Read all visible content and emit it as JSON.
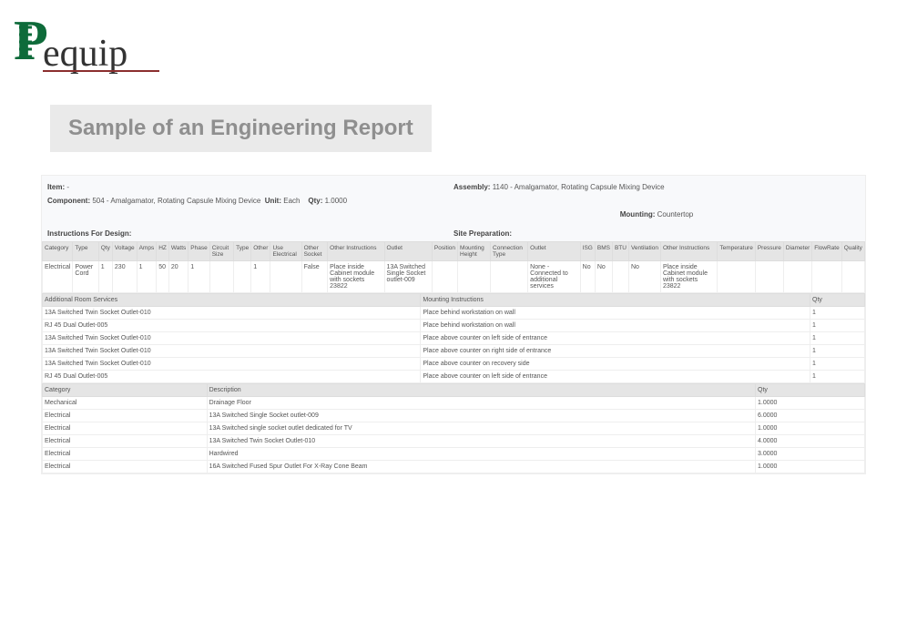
{
  "logo_text": "equip",
  "page_title": "Sample of an Engineering Report",
  "meta": {
    "item_label": "Item:",
    "item_value": "-",
    "assembly_label": "Assembly:",
    "assembly_value": "1140 - Amalgamator, Rotating Capsule Mixing Device",
    "component_label": "Component:",
    "component_value": "504 - Amalgamator, Rotating Capsule Mixing Device",
    "unit_label": "Unit:",
    "unit_value": "Each",
    "qty_label": "Qty:",
    "qty_value": "1.0000",
    "mounting_label": "Mounting:",
    "mounting_value": "Countertop",
    "instr_design": "Instructions For Design:",
    "site_prep": "Site Preparation:"
  },
  "main_headers": [
    "Category",
    "Type",
    "Qty",
    "Voltage",
    "Amps",
    "HZ",
    "Watts",
    "Phase",
    "Circuit Size",
    "Type",
    "Other",
    "Use Electrical",
    "Other Socket",
    "Other Instructions",
    "Outlet",
    "Position",
    "Mounting Height",
    "Connection Type",
    "Outlet",
    "ISG",
    "BMS",
    "BTU",
    "Ventilation",
    "Other Instructions",
    "Temperature",
    "Pressure",
    "Diameter",
    "FlowRate",
    "Quality"
  ],
  "main_row": {
    "category": "Electrical",
    "type": "Power Cord",
    "qty": "1",
    "voltage": "230",
    "amps": "1",
    "hz": "50",
    "watts": "20",
    "phase": "1",
    "circuit_size": "",
    "type2": "",
    "other": "1",
    "use_elec": "",
    "other_socket": "False",
    "other_instr": "Place inside Cabinet module with sockets 23822",
    "outlet": "13A Switched Single Socket outlet-009",
    "position": "",
    "mounting_height": "",
    "conn_type": "",
    "outlet2": "None - Connected to additional services",
    "isg": "No",
    "bms": "No",
    "btu": "",
    "vent": "No",
    "other_instr2": "Place inside Cabinet module with sockets 23822",
    "temp": "",
    "pressure": "",
    "diameter": "",
    "flowrate": "",
    "quality": ""
  },
  "room_services": {
    "hdr_left": "Additional Room Services",
    "hdr_mid": "Mounting Instructions",
    "hdr_right": "Qty",
    "rows": [
      {
        "name": "13A Switched Twin Socket Outlet-010",
        "instr": "Place behind workstation on wall",
        "qty": "1"
      },
      {
        "name": "RJ 45 Dual Outlet-005",
        "instr": "Place behind workstation on wall",
        "qty": "1"
      },
      {
        "name": "13A Switched Twin Socket Outlet-010",
        "instr": "Place above counter on left side of entrance",
        "qty": "1"
      },
      {
        "name": "13A Switched Twin Socket Outlet-010",
        "instr": "Place above counter on right side of entrance",
        "qty": "1"
      },
      {
        "name": "13A Switched Twin Socket Outlet-010",
        "instr": "Place above counter on recovery side",
        "qty": "1"
      },
      {
        "name": "RJ 45 Dual Outlet-005",
        "instr": "Place above counter on left side of entrance",
        "qty": "1"
      }
    ]
  },
  "cat_table": {
    "hdr_cat": "Category",
    "hdr_desc": "Description",
    "hdr_qty": "Qty",
    "rows": [
      {
        "cat": "Mechanical",
        "desc": "Drainage Floor",
        "qty": "1.0000"
      },
      {
        "cat": "Electrical",
        "desc": "13A Switched Single Socket outlet-009",
        "qty": "6.0000"
      },
      {
        "cat": "Electrical",
        "desc": "13A Switched single socket outlet dedicated for TV",
        "qty": "1.0000"
      },
      {
        "cat": "Electrical",
        "desc": "13A Switched Twin Socket Outlet-010",
        "qty": "4.0000"
      },
      {
        "cat": "Electrical",
        "desc": "Hardwired",
        "qty": "3.0000"
      },
      {
        "cat": "Electrical",
        "desc": "16A Switched Fused Spur Outlet For X-Ray Cone Beam",
        "qty": "1.0000"
      }
    ]
  }
}
